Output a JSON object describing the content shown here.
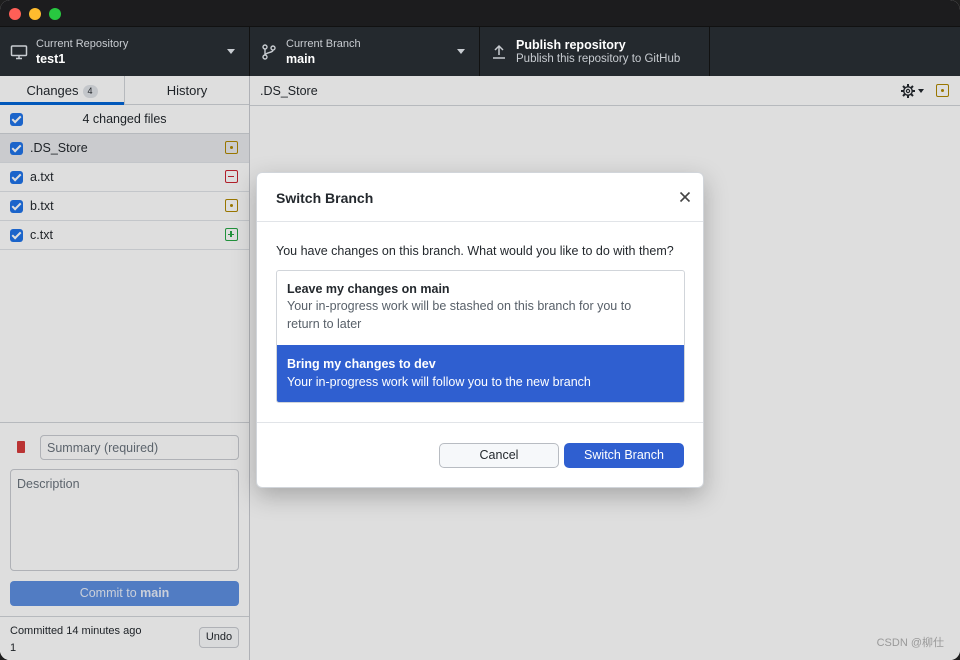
{
  "toolbar": {
    "repo": {
      "label": "Current Repository",
      "value": "test1"
    },
    "branch": {
      "label": "Current Branch",
      "value": "main"
    },
    "publish": {
      "title": "Publish repository",
      "subtitle": "Publish this repository to GitHub"
    }
  },
  "sidebar": {
    "tabs": [
      {
        "label": "Changes",
        "count": "4"
      },
      {
        "label": "History"
      }
    ],
    "changed_files_label": "4 changed files",
    "files": [
      {
        "name": ".DS_Store",
        "status": "modified"
      },
      {
        "name": "a.txt",
        "status": "deleted"
      },
      {
        "name": "b.txt",
        "status": "modified"
      },
      {
        "name": "c.txt",
        "status": "added"
      }
    ],
    "commit": {
      "summary_placeholder": "Summary (required)",
      "description_placeholder": "Description",
      "button_prefix": "Commit to ",
      "button_branch": "main"
    },
    "last_commit": {
      "text": "Committed 14 minutes ago",
      "message": "1",
      "undo_label": "Undo"
    }
  },
  "main": {
    "file_path": ".DS_Store"
  },
  "dialog": {
    "title": "Switch Branch",
    "question": "You have changes on this branch. What would you like to do with them?",
    "options": [
      {
        "title": "Leave my changes on main",
        "description": "Your in-progress work will be stashed on this branch for you to return to later",
        "selected": false
      },
      {
        "title": "Bring my changes to dev",
        "description": "Your in-progress work will follow you to the new branch",
        "selected": true
      }
    ],
    "cancel_label": "Cancel",
    "confirm_label": "Switch Branch"
  },
  "watermark": "CSDN @柳仕",
  "colors": {
    "accent": "#2f5fd0",
    "toolbar_bg": "#24292e",
    "modified": "#b08800",
    "deleted": "#cb2431",
    "added": "#28a745"
  }
}
